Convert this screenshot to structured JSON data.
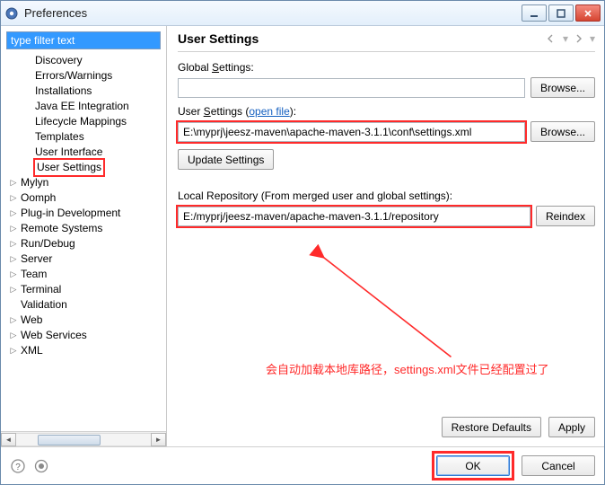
{
  "window": {
    "title": "Preferences"
  },
  "filter": {
    "value": "type filter text"
  },
  "tree": [
    {
      "level": 2,
      "label": "Discovery",
      "expand": ""
    },
    {
      "level": 2,
      "label": "Errors/Warnings",
      "expand": ""
    },
    {
      "level": 2,
      "label": "Installations",
      "expand": ""
    },
    {
      "level": 2,
      "label": "Java EE Integration",
      "expand": ""
    },
    {
      "level": 2,
      "label": "Lifecycle Mappings",
      "expand": ""
    },
    {
      "level": 2,
      "label": "Templates",
      "expand": ""
    },
    {
      "level": 2,
      "label": "User Interface",
      "expand": ""
    },
    {
      "level": 2,
      "label": "User Settings",
      "expand": "",
      "highlight": true
    },
    {
      "level": 1,
      "label": "Mylyn",
      "expand": "▷"
    },
    {
      "level": 1,
      "label": "Oomph",
      "expand": "▷"
    },
    {
      "level": 1,
      "label": "Plug-in Development",
      "expand": "▷"
    },
    {
      "level": 1,
      "label": "Remote Systems",
      "expand": "▷"
    },
    {
      "level": 1,
      "label": "Run/Debug",
      "expand": "▷"
    },
    {
      "level": 1,
      "label": "Server",
      "expand": "▷"
    },
    {
      "level": 1,
      "label": "Team",
      "expand": "▷"
    },
    {
      "level": 1,
      "label": "Terminal",
      "expand": "▷"
    },
    {
      "level": 1,
      "label": "Validation",
      "expand": ""
    },
    {
      "level": 1,
      "label": "Web",
      "expand": "▷"
    },
    {
      "level": 1,
      "label": "Web Services",
      "expand": "▷"
    },
    {
      "level": 1,
      "label": "XML",
      "expand": "▷"
    }
  ],
  "page": {
    "title": "User Settings",
    "globalSettings": {
      "label_pre": "Global ",
      "label_mn": "S",
      "label_post": "ettings:",
      "value": "",
      "browse": "Browse..."
    },
    "userSettings": {
      "label_pre": "User ",
      "label_mn": "S",
      "label_post": "ettings (",
      "openfile": "open file",
      "label_end": "):",
      "value": "E:\\myprj\\jeesz-maven\\apache-maven-3.1.1\\conf\\settings.xml",
      "browse": "Browse...",
      "update": "Update Settings"
    },
    "localRepo": {
      "label": "Local Repository (From merged user and global settings):",
      "value": "E:/myprj/jeesz-maven/apache-maven-3.1.1/repository",
      "reindex": "Reindex"
    },
    "restore": "Restore Defaults",
    "apply": "Apply"
  },
  "annotation": "会自动加载本地库路径，settings.xml文件已经配置过了",
  "footer": {
    "ok": "OK",
    "cancel": "Cancel"
  }
}
